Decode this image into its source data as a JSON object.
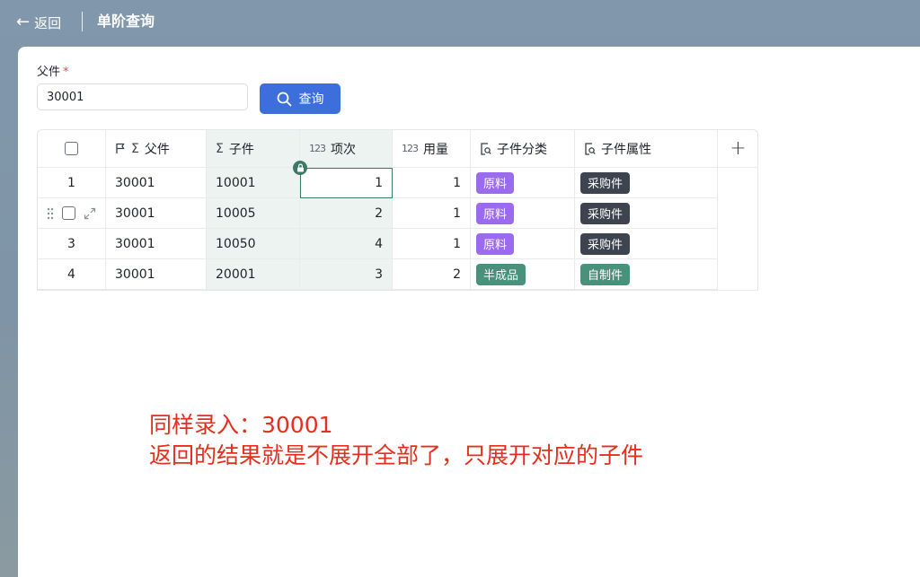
{
  "header": {
    "back_label": "返回",
    "title": "单阶查询"
  },
  "form": {
    "parent_label": "父件",
    "required_mark": "*",
    "parent_value": "30001",
    "query_label": "查询"
  },
  "table": {
    "columns": [
      "父件",
      "子件",
      "项次",
      "用量",
      "子件分类",
      "子件属性"
    ],
    "rows": [
      {
        "index": "1",
        "parent": "30001",
        "child": "10001",
        "seq": "1",
        "qty": "1",
        "category": "原料",
        "attribute": "采购件"
      },
      {
        "index": "2",
        "parent": "30001",
        "child": "10005",
        "seq": "2",
        "qty": "1",
        "category": "原料",
        "attribute": "采购件"
      },
      {
        "index": "3",
        "parent": "30001",
        "child": "10050",
        "seq": "4",
        "qty": "1",
        "category": "原料",
        "attribute": "采购件"
      },
      {
        "index": "4",
        "parent": "30001",
        "child": "20001",
        "seq": "3",
        "qty": "2",
        "category": "半成品",
        "attribute": "自制件"
      }
    ]
  },
  "colors": {
    "tag_raw_material": "#9b6bed",
    "tag_semi_finished": "#4a917c",
    "tag_purchased": "#3d4450",
    "tag_self_made": "#4a917c",
    "primary": "#3d6fdc",
    "note": "#e62e1e"
  },
  "annotation": {
    "line1": "同样录入：30001",
    "line2": "返回的结果就是不展开全部了，只展开对应的子件"
  },
  "icons": [
    "back-arrow-icon",
    "search-icon",
    "flag-icon",
    "sigma-icon",
    "number-icon",
    "lookup-icon",
    "lock-icon",
    "drag-handle-icon",
    "expand-icon",
    "add-icon"
  ]
}
